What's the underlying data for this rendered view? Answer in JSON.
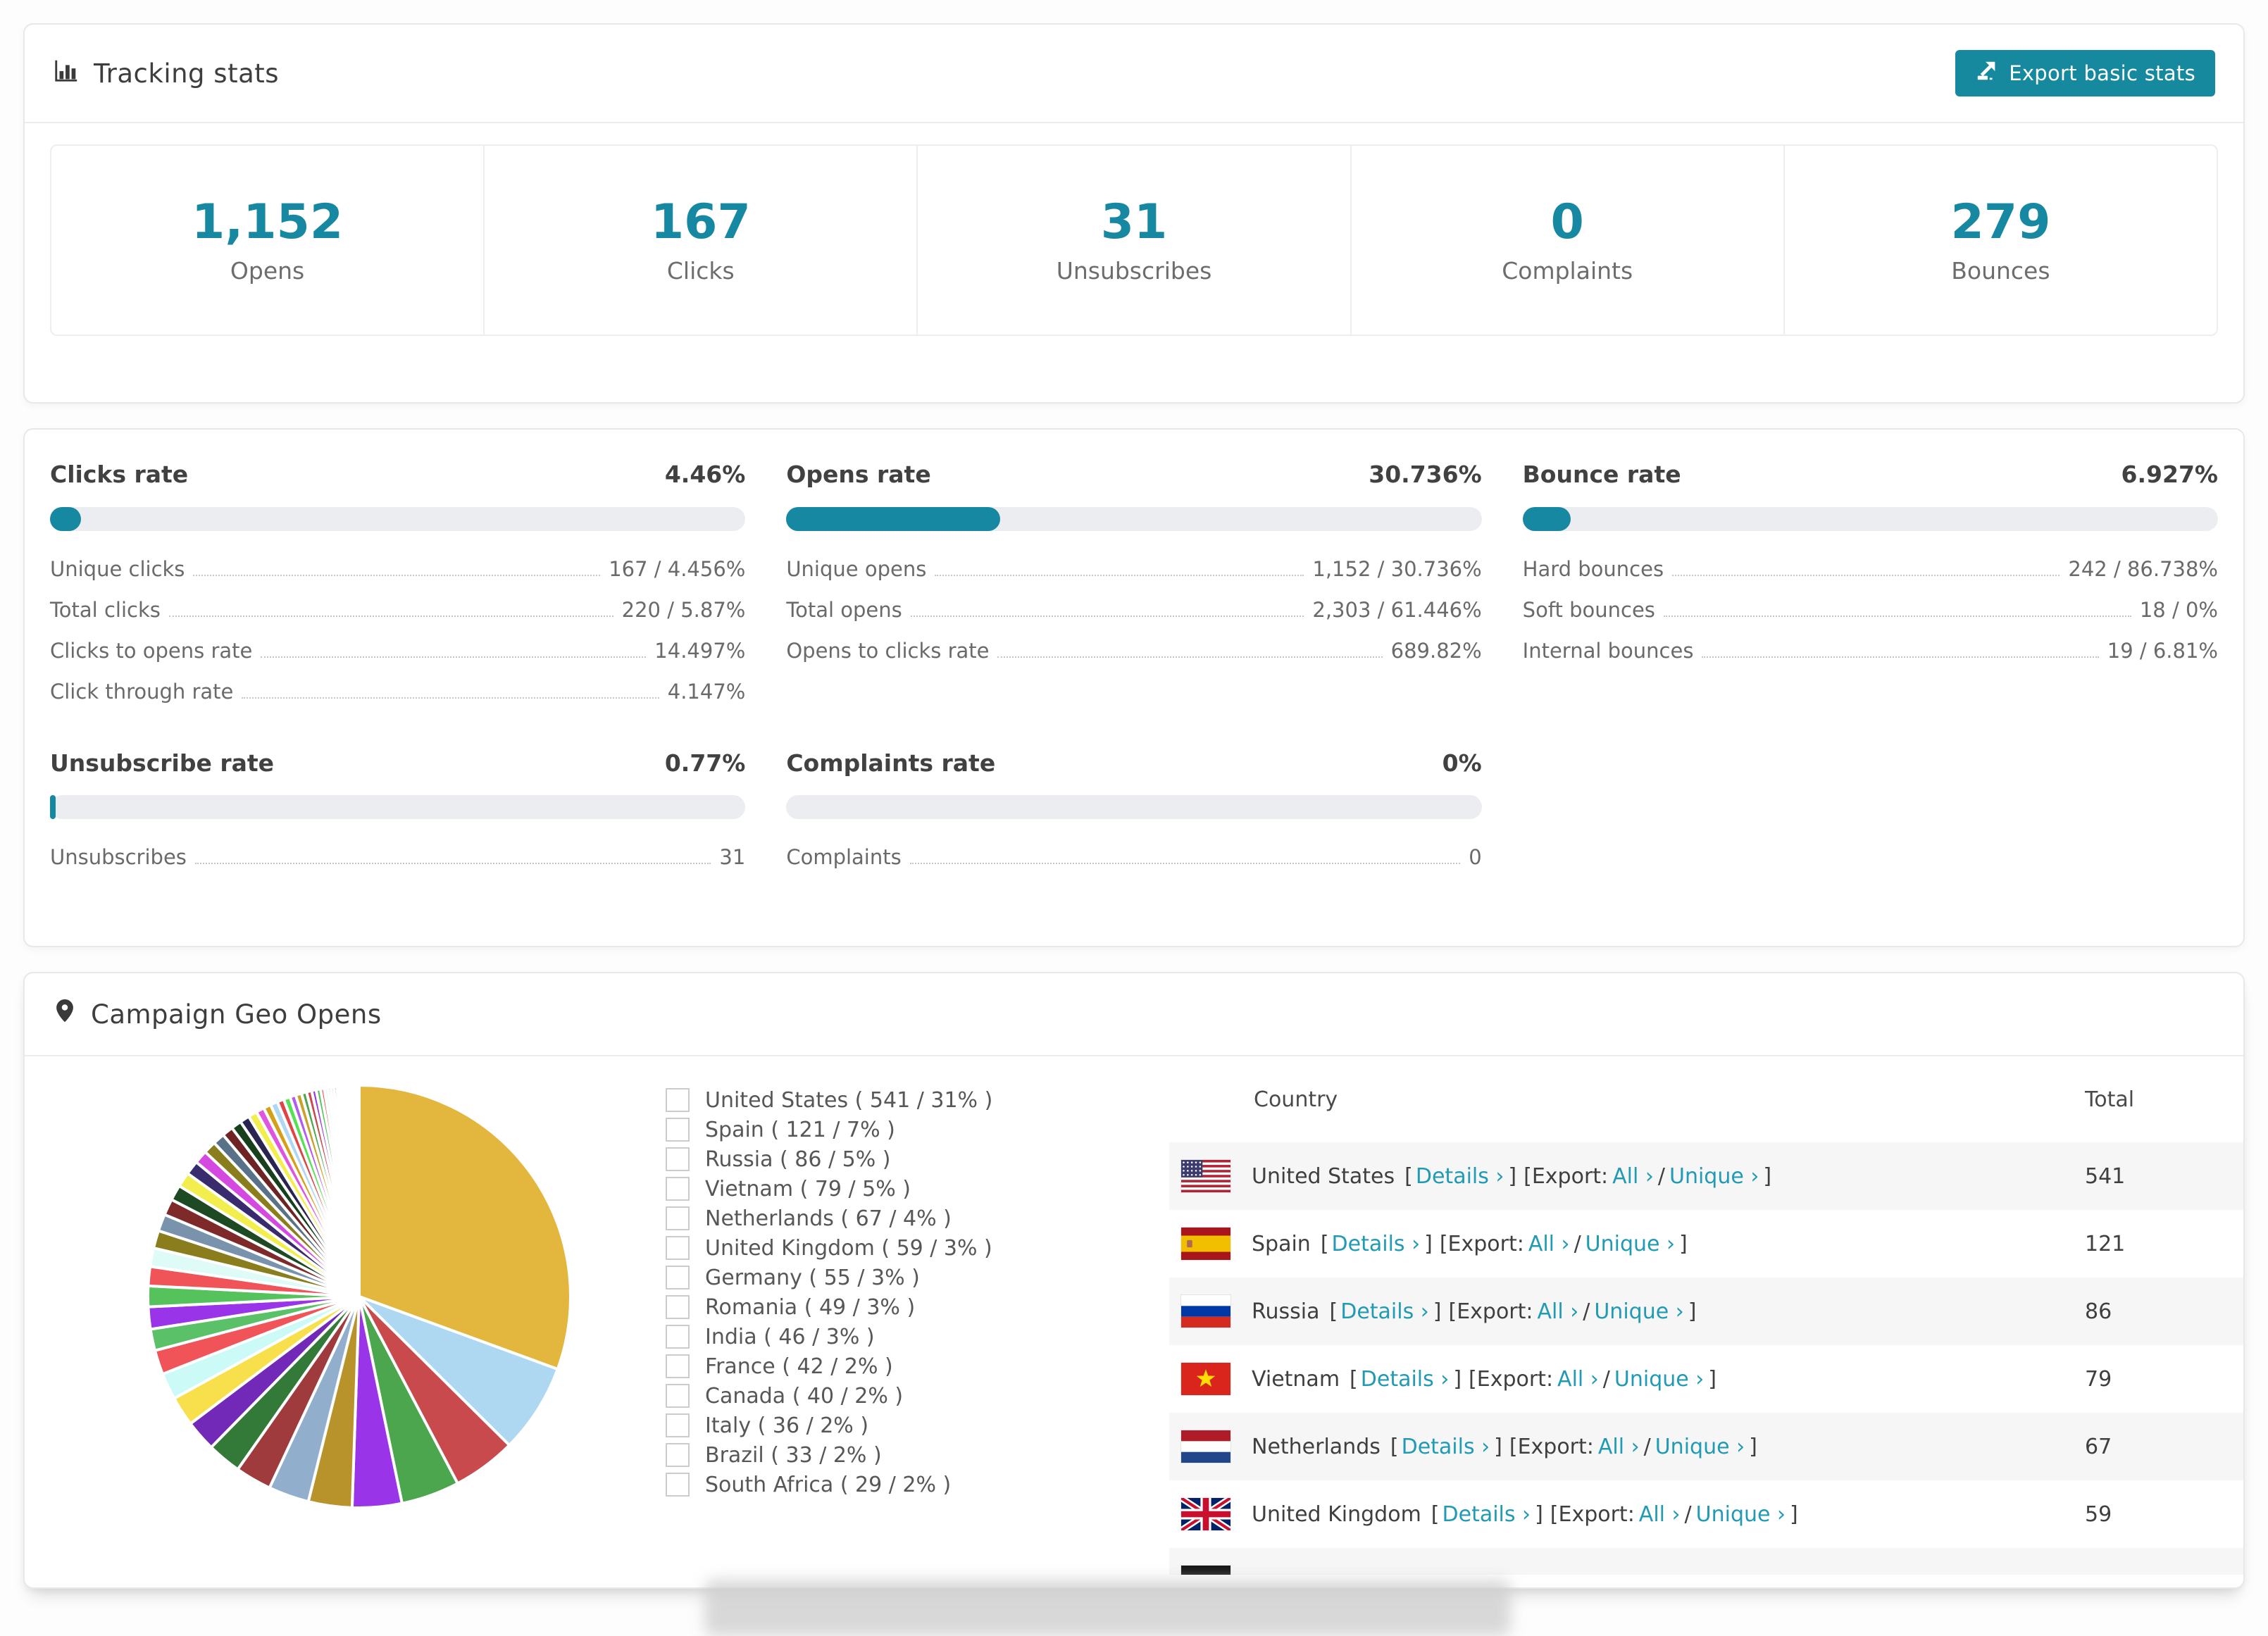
{
  "colors": {
    "teal": "#1788a2",
    "link": "#219ab3",
    "title_text": "#3e3e3e",
    "label_text": "#6d6d6d",
    "bar_track": "#ebedf0",
    "row_alt_bg": "#f6f6f7",
    "card_border": "#e8e8eb"
  },
  "tracking": {
    "title": "Tracking stats",
    "export_label": "Export basic stats",
    "stats": [
      {
        "value": "1,152",
        "label": "Opens"
      },
      {
        "value": "167",
        "label": "Clicks"
      },
      {
        "value": "31",
        "label": "Unsubscribes"
      },
      {
        "value": "0",
        "label": "Complaints"
      },
      {
        "value": "279",
        "label": "Bounces"
      }
    ]
  },
  "rates": [
    {
      "title": "Clicks rate",
      "value": "4.46%",
      "percent": 4.46,
      "rows": [
        [
          "Unique clicks",
          "167 / 4.456%"
        ],
        [
          "Total clicks",
          "220 / 5.87%"
        ],
        [
          "Clicks to opens rate",
          "14.497%"
        ],
        [
          "Click through rate",
          "4.147%"
        ]
      ]
    },
    {
      "title": "Opens rate",
      "value": "30.736%",
      "percent": 30.736,
      "rows": [
        [
          "Unique opens",
          "1,152 / 30.736%"
        ],
        [
          "Total opens",
          "2,303 / 61.446%"
        ],
        [
          "Opens to clicks rate",
          "689.82%"
        ]
      ]
    },
    {
      "title": "Bounce rate",
      "value": "6.927%",
      "percent": 6.927,
      "rows": [
        [
          "Hard bounces",
          "242 / 86.738%"
        ],
        [
          "Soft bounces",
          "18 / 0%"
        ],
        [
          "Internal bounces",
          "19 / 6.81%"
        ]
      ]
    },
    {
      "title": "Unsubscribe rate",
      "value": "0.77%",
      "percent": 0.77,
      "rows": [
        [
          "Unsubscribes",
          "31"
        ]
      ]
    },
    {
      "title": "Complaints rate",
      "value": "0%",
      "percent": 0,
      "rows": [
        [
          "Complaints",
          "0"
        ]
      ]
    }
  ],
  "geo": {
    "title": "Campaign Geo Opens",
    "legend_format": "name ( count / pct% )",
    "table": {
      "headers": [
        "Country",
        "Total"
      ],
      "link_labels": {
        "bracket_open": "[",
        "bracket_close": "]",
        "details": "Details ›",
        "export_prefix": "[Export:",
        "all": "All ›",
        "slash": "/",
        "unique": "Unique ›"
      },
      "rows": [
        {
          "country": "United States",
          "flag": "us",
          "total": "541"
        },
        {
          "country": "Spain",
          "flag": "es",
          "total": "121"
        },
        {
          "country": "Russia",
          "flag": "ru",
          "total": "86"
        },
        {
          "country": "Vietnam",
          "flag": "vn",
          "total": "79"
        },
        {
          "country": "Netherlands",
          "flag": "nl",
          "total": "67"
        },
        {
          "country": "United Kingdom",
          "flag": "gb",
          "total": "59"
        }
      ],
      "partial_row": {
        "flag": "de"
      }
    }
  },
  "chart_data": {
    "type": "pie",
    "title": "Campaign Geo Opens",
    "unit": "opens",
    "legend_position": "right",
    "slices": [
      {
        "label": "United States",
        "value": 541,
        "pct": 31,
        "color": "#e3b63e"
      },
      {
        "label": "Spain",
        "value": 121,
        "pct": 7,
        "color": "#aed7f2"
      },
      {
        "label": "Russia",
        "value": 86,
        "pct": 5,
        "color": "#c94a4d"
      },
      {
        "label": "Vietnam",
        "value": 79,
        "pct": 5,
        "color": "#4ca64e"
      },
      {
        "label": "Netherlands",
        "value": 67,
        "pct": 4,
        "color": "#9934e8"
      },
      {
        "label": "United Kingdom",
        "value": 59,
        "pct": 3,
        "color": "#b8932b"
      },
      {
        "label": "Germany",
        "value": 55,
        "pct": 3,
        "color": "#91afcc"
      },
      {
        "label": "Romania",
        "value": 49,
        "pct": 3,
        "color": "#a03b3d"
      },
      {
        "label": "India",
        "value": 46,
        "pct": 3,
        "color": "#337a38"
      },
      {
        "label": "France",
        "value": 42,
        "pct": 2,
        "color": "#7229b8"
      },
      {
        "label": "Canada",
        "value": 40,
        "pct": 2,
        "color": "#f7e04b"
      },
      {
        "label": "Italy",
        "value": 36,
        "pct": 2,
        "color": "#ccfbf7"
      },
      {
        "label": "Brazil",
        "value": 33,
        "pct": 2,
        "color": "#f05458"
      },
      {
        "label": "South Africa",
        "value": 29,
        "pct": 2,
        "color": "#5bc168"
      }
    ],
    "others_values": [
      30,
      28,
      26,
      25,
      24,
      23,
      22,
      21,
      20,
      19,
      18,
      17,
      16,
      15,
      14,
      13,
      12,
      11,
      10,
      10,
      9,
      9,
      8,
      8,
      7,
      7,
      6,
      6,
      5,
      5,
      4,
      4,
      4,
      3,
      3,
      3,
      3,
      2,
      2,
      2,
      2,
      2,
      1,
      1,
      1,
      1,
      1,
      1,
      1,
      1
    ],
    "others_palette": [
      "#9934e8",
      "#55c25c",
      "#f05458",
      "#dffbf7",
      "#8a7d1e",
      "#7a93ad",
      "#7e2a2a",
      "#1d4a22",
      "#f2ee4e",
      "#3a2a6e",
      "#d44ae0",
      "#8a7d1e",
      "#5a7288",
      "#6e2424",
      "#17401c",
      "#2a2550",
      "#f2ee4e",
      "#e055e0",
      "#d4a017",
      "#aed7f2",
      "#e04444",
      "#55e055",
      "#b05cf0",
      "#c9a227",
      "#4ca64e",
      "#c94a4d"
    ]
  }
}
